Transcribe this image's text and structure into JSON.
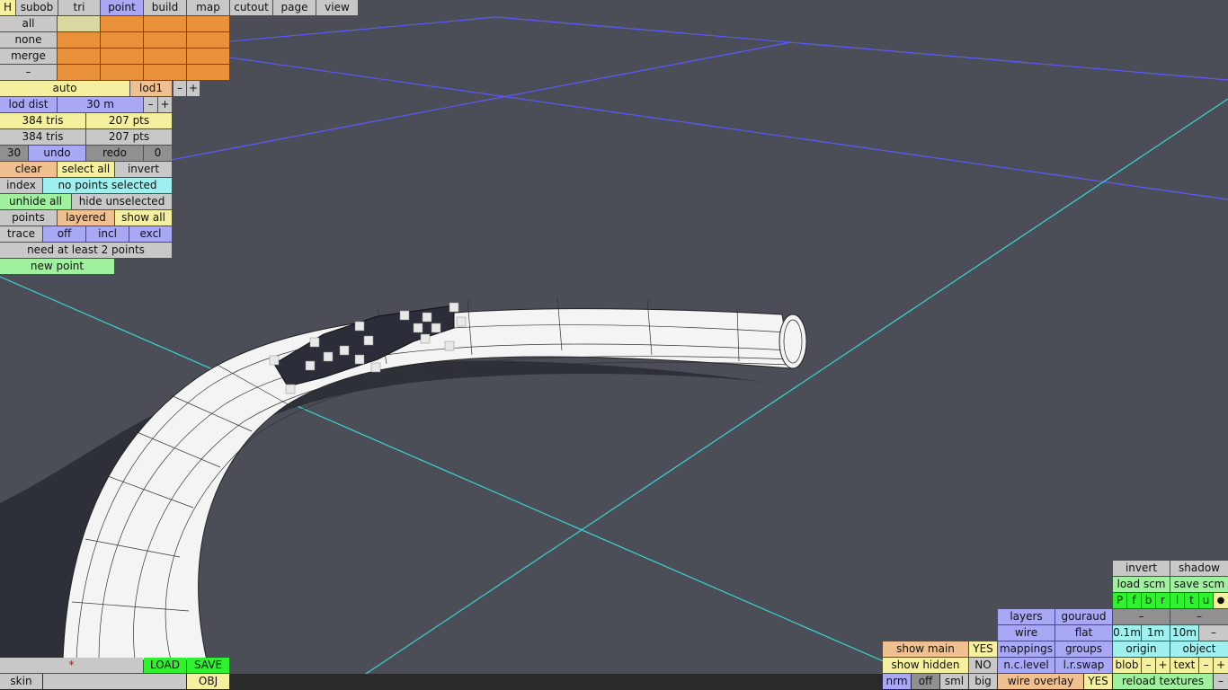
{
  "tabs": [
    {
      "id": "h",
      "label": "H"
    },
    {
      "id": "subob",
      "label": "subob"
    },
    {
      "id": "tri",
      "label": "tri"
    },
    {
      "id": "point",
      "label": "point"
    },
    {
      "id": "build",
      "label": "build"
    },
    {
      "id": "map",
      "label": "map"
    },
    {
      "id": "cutout",
      "label": "cutout"
    },
    {
      "id": "page",
      "label": "page"
    },
    {
      "id": "view",
      "label": "view"
    }
  ],
  "selection": {
    "all": "all",
    "none": "none",
    "merge": "merge",
    "dash": "–"
  },
  "lod": {
    "auto": "auto",
    "level": "lod1",
    "minus": "–",
    "plus": "+",
    "dist_label": "lod dist",
    "dist_value": "30 m"
  },
  "stats": {
    "tris_1": "384 tris",
    "pts_1": "207 pts",
    "tris_2": "384 tris",
    "pts_2": "207 pts"
  },
  "history": {
    "undo_count": "30",
    "undo": "undo",
    "redo": "redo",
    "redo_count": "0"
  },
  "ops": {
    "clear": "clear",
    "select_all": "select all",
    "invert": "invert",
    "index": "index",
    "status": "no points selected",
    "unhide_all": "unhide all",
    "hide_unselected": "hide unselected",
    "points": "points",
    "layered": "layered",
    "show_all": "show all",
    "trace": "trace",
    "off": "off",
    "incl": "incl",
    "excl": "excl",
    "need": "need at least 2 points",
    "new_point": "new point"
  },
  "bottom_left": {
    "star": "*",
    "load": "LOAD",
    "save": "SAVE",
    "skin": "skin",
    "obj": "OBJ"
  },
  "bottom_right": {
    "show_main": "show main",
    "show_main_val": "YES",
    "show_hidden": "show hidden",
    "show_hidden_val": "NO",
    "nrm": "nrm",
    "off": "off",
    "sml": "sml",
    "big": "big",
    "layers": "layers",
    "gouraud": "gouraud",
    "wire": "wire",
    "flat": "flat",
    "mappings": "mappings",
    "groups": "groups",
    "nc_level": "n.c.level",
    "lr_swap": "l.r.swap",
    "wire_overlay": "wire overlay",
    "wire_overlay_val": "YES",
    "invert": "invert",
    "shadow": "shadow",
    "load_scm": "load scm",
    "save_scm": "save scm",
    "flags": [
      "P",
      "f",
      "b",
      "r",
      "l",
      "t",
      "u"
    ],
    "dot": "●",
    "dash1": "–",
    "dash2": "–",
    "s01": "0.1m",
    "s1": "1m",
    "s10": "10m",
    "sminus": "–",
    "origin": "origin",
    "object": "object",
    "blob": "blob",
    "blob_minus": "–",
    "blob_plus": "+",
    "text": "text",
    "text_minus": "–",
    "text_plus": "+",
    "reload": "reload textures",
    "reload_minus": "–"
  }
}
